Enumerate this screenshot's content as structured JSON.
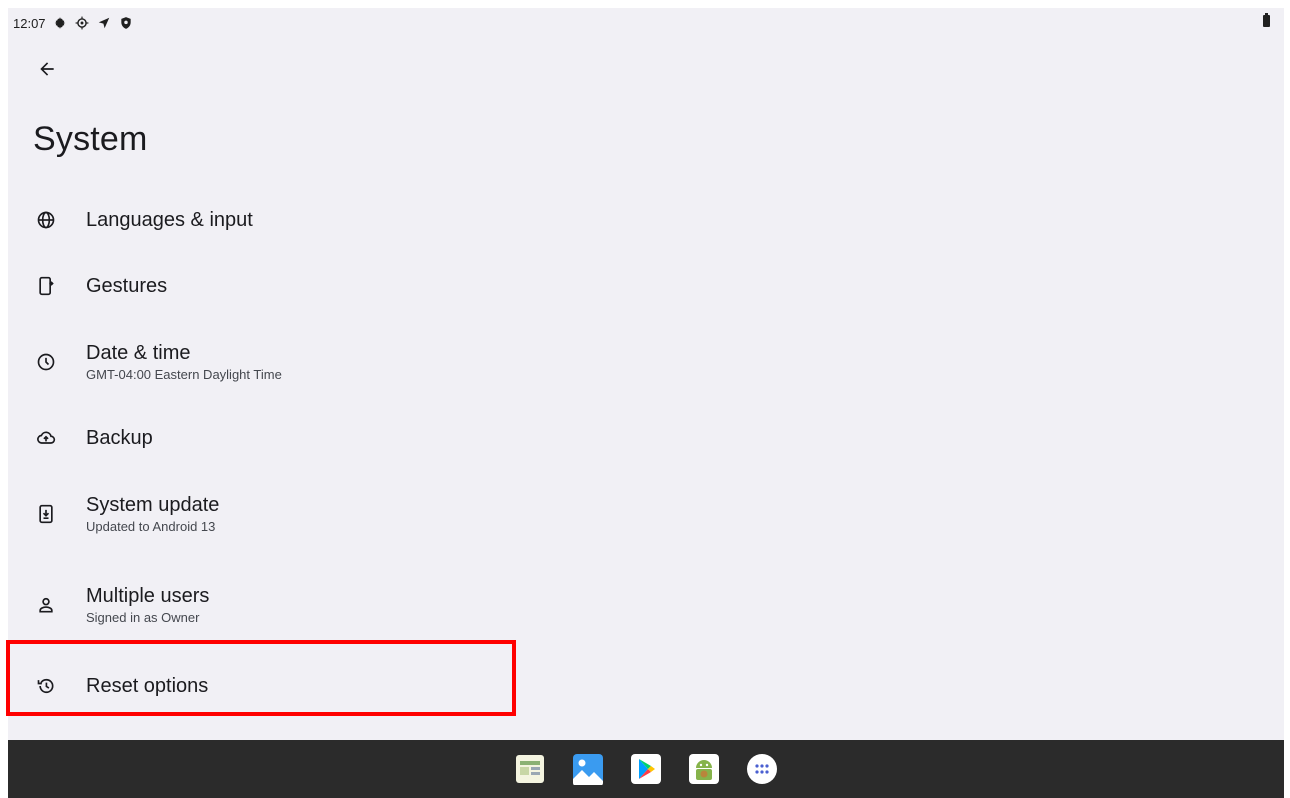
{
  "status_bar": {
    "time": "12:07",
    "icons": [
      "settings-icon",
      "gear-alt-icon",
      "location-arrow-icon",
      "shield-icon",
      "battery-icon"
    ]
  },
  "page": {
    "title": "System"
  },
  "items": [
    {
      "title": "Languages & input",
      "summary": "",
      "icon": "globe-icon"
    },
    {
      "title": "Gestures",
      "summary": "",
      "icon": "phone-gesture-icon"
    },
    {
      "title": "Date & time",
      "summary": "GMT-04:00 Eastern Daylight Time",
      "icon": "clock-icon"
    },
    {
      "title": "Backup",
      "summary": "",
      "icon": "cloud-upload-icon"
    },
    {
      "title": "System update",
      "summary": "Updated to Android 13",
      "icon": "system-update-icon"
    },
    {
      "title": "Multiple users",
      "summary": "Signed in as Owner",
      "icon": "person-icon"
    },
    {
      "title": "Reset options",
      "summary": "",
      "icon": "history-icon"
    }
  ],
  "taskbar": {
    "apps": [
      "app-1-icon",
      "gallery-icon",
      "play-store-icon",
      "android-app-icon",
      "all-apps-icon"
    ]
  },
  "colors": {
    "background": "#f1f0f5",
    "taskbar": "#2b2b2b",
    "highlight": "#ff0000"
  }
}
